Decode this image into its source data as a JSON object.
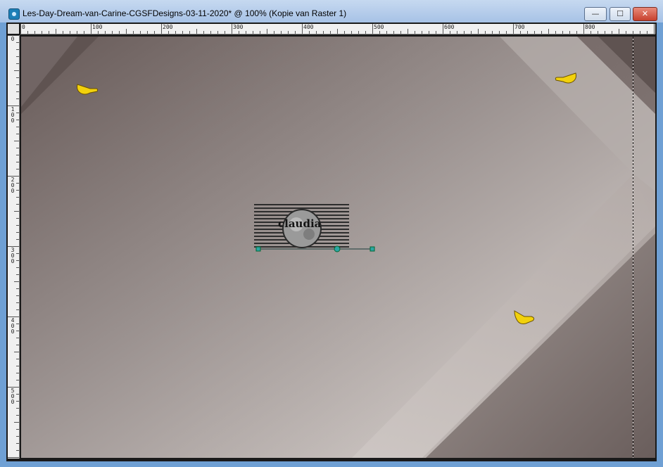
{
  "window": {
    "title": "Les-Day-Dream-van-Carine-CGSFDesigns-03-11-2020* @ 100% (Kopie van Raster 1)",
    "controls": {
      "minimize": "—",
      "maximize": "☐",
      "close": "✕"
    }
  },
  "ruler": {
    "top_labels": [
      "0",
      "100",
      "200",
      "300",
      "400",
      "500",
      "600",
      "700",
      "800"
    ],
    "left_labels": [
      "0",
      "100",
      "200",
      "300",
      "400",
      "500"
    ]
  },
  "canvas": {
    "logo_text": "claudia",
    "colors": {
      "dark_taupe": "#6e6260",
      "mid_taupe": "#9a8f8d",
      "light_taupe": "#d6cfcc",
      "selection_handle": "#2aa6a3"
    }
  }
}
